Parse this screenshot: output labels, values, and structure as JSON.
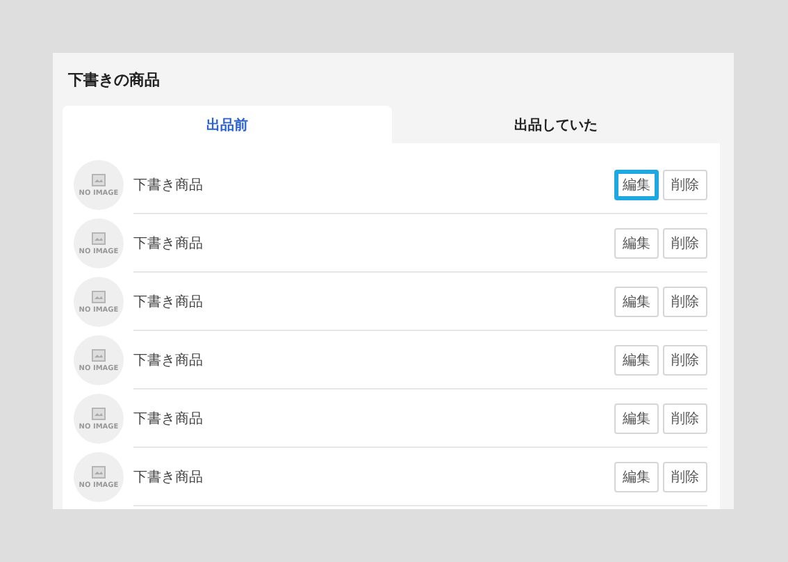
{
  "title": "下書きの商品",
  "tabs": [
    {
      "label": "出品前",
      "selected": true
    },
    {
      "label": "出品していた",
      "selected": false
    }
  ],
  "items": [
    {
      "name": "下書き商品",
      "placeholder_text": "NO IMAGE",
      "buttons": [
        {
          "label": "編集",
          "highlighted": true
        },
        {
          "label": "削除",
          "highlighted": false
        }
      ]
    },
    {
      "name": "下書き商品",
      "placeholder_text": "NO IMAGE",
      "buttons": [
        {
          "label": "編集",
          "highlighted": false
        },
        {
          "label": "削除",
          "highlighted": false
        }
      ]
    },
    {
      "name": "下書き商品",
      "placeholder_text": "NO IMAGE",
      "buttons": [
        {
          "label": "編集",
          "highlighted": false
        },
        {
          "label": "削除",
          "highlighted": false
        }
      ]
    },
    {
      "name": "下書き商品",
      "placeholder_text": "NO IMAGE",
      "buttons": [
        {
          "label": "編集",
          "highlighted": false
        },
        {
          "label": "削除",
          "highlighted": false
        }
      ]
    },
    {
      "name": "下書き商品",
      "placeholder_text": "NO IMAGE",
      "buttons": [
        {
          "label": "編集",
          "highlighted": false
        },
        {
          "label": "削除",
          "highlighted": false
        }
      ]
    },
    {
      "name": "下書き商品",
      "placeholder_text": "NO IMAGE",
      "buttons": [
        {
          "label": "編集",
          "highlighted": false
        },
        {
          "label": "削除",
          "highlighted": false
        }
      ]
    }
  ]
}
